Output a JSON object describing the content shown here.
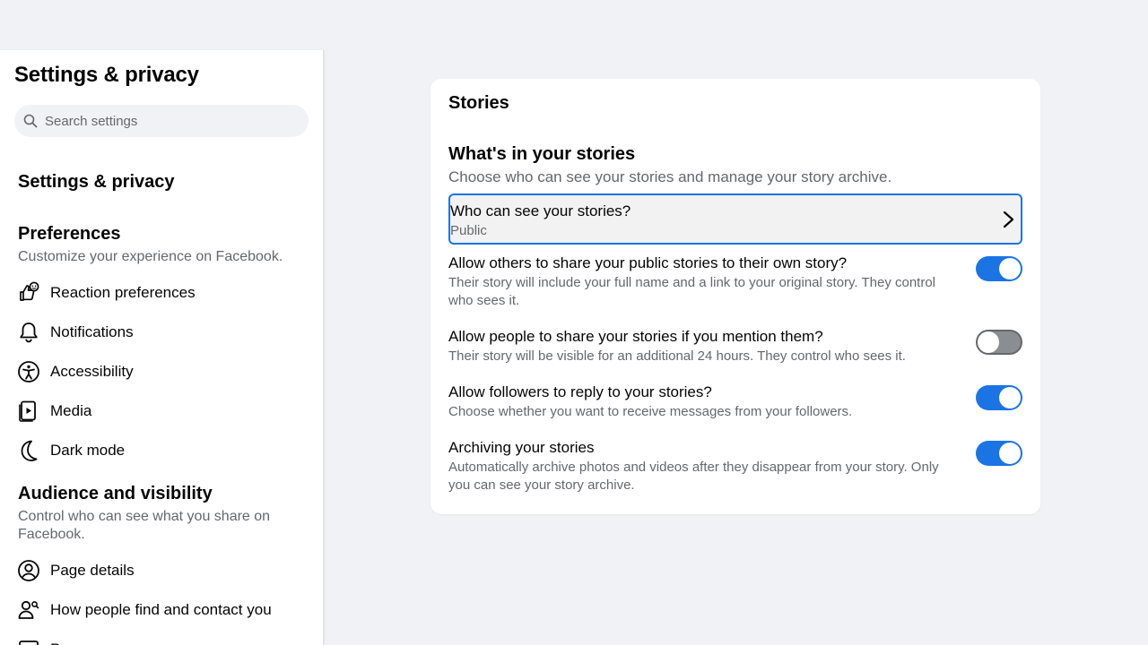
{
  "sidebar": {
    "header_title": "Settings & privacy",
    "search_placeholder": "Search settings",
    "top_section_title": "Settings & privacy",
    "preferences": {
      "title": "Preferences",
      "subtitle": "Customize your experience on Facebook.",
      "items": [
        {
          "label": "Reaction preferences",
          "icon": "reaction-icon"
        },
        {
          "label": "Notifications",
          "icon": "bell-icon"
        },
        {
          "label": "Accessibility",
          "icon": "accessibility-icon"
        },
        {
          "label": "Media",
          "icon": "media-icon"
        },
        {
          "label": "Dark mode",
          "icon": "moon-icon"
        }
      ]
    },
    "audience": {
      "title": "Audience and visibility",
      "subtitle": "Control who can see what you share on Facebook.",
      "items": [
        {
          "label": "Page details",
          "icon": "user-circle-icon"
        },
        {
          "label": "How people find and contact you",
          "icon": "people-search-icon"
        },
        {
          "label": "P",
          "icon": "id-card-icon"
        }
      ]
    }
  },
  "main": {
    "card_title": "Stories",
    "section_title": "What's in your stories",
    "section_subtitle": "Choose who can see your stories and manage your story archive.",
    "audience_row": {
      "title": "Who can see your stories?",
      "value": "Public"
    },
    "options": [
      {
        "title": "Allow others to share your public stories to their own story?",
        "description": "Their story will include your full name and a link to your original story. They control who sees it.",
        "enabled": true
      },
      {
        "title": "Allow people to share your stories if you mention them?",
        "description": "Their story will be visible for an additional 24 hours. They control who sees it.",
        "enabled": false
      },
      {
        "title": "Allow followers to reply to your stories?",
        "description": "Choose whether you want to receive messages from your followers.",
        "enabled": true
      },
      {
        "title": "Archiving your stories",
        "description": "Automatically archive photos and videos after they disappear from your story. Only you can see your story archive.",
        "enabled": true
      }
    ]
  },
  "colors": {
    "accent": "#1b74e4",
    "background": "#f0f2f5",
    "secondary_text": "#65676b"
  }
}
